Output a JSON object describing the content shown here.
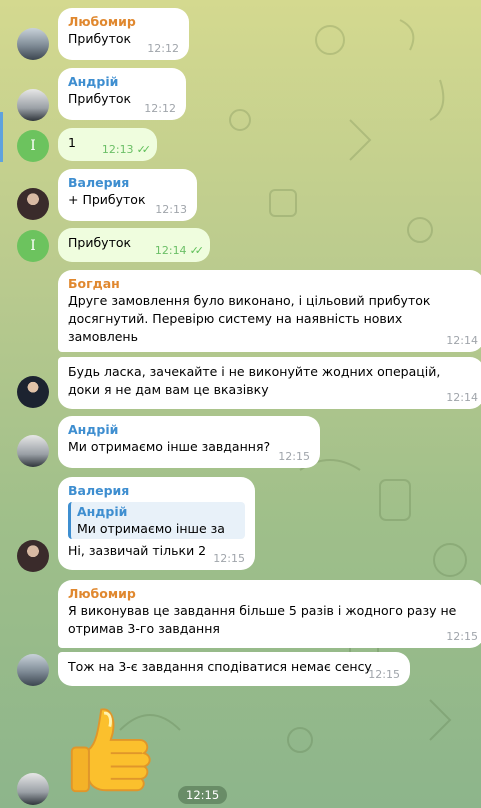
{
  "messages": [
    {
      "sender": "Любомир",
      "text": "Прибуток",
      "time": "12:12"
    },
    {
      "sender": "Андрій",
      "text": "Прибуток",
      "time": "12:12"
    },
    {
      "text": "1",
      "time": "12:13"
    },
    {
      "sender": "Валерия",
      "text": "+ Прибуток",
      "time": "12:13"
    },
    {
      "text": "Прибуток",
      "time": "12:14"
    },
    {
      "sender": "Богдан",
      "text": "Друге замовлення було виконано, і цільовий прибуток досягнутий. Перевірю систему на наявність нових замовлень",
      "time": "12:14"
    },
    {
      "text": "Будь ласка, зачекайте і не виконуйте жодних операцій, доки я не дам вам це вказівку",
      "time": "12:14"
    },
    {
      "sender": "Андрій",
      "text": "Ми отримаємо інше завдання?",
      "time": "12:15"
    },
    {
      "sender": "Валерия",
      "reply": {
        "name": "Андрій",
        "text": "Ми отримаємо інше за"
      },
      "text": "Ні, зазвичай тільки 2",
      "time": "12:15"
    },
    {
      "sender": "Любомир",
      "text": "Я виконував це завдання більше 5 разів і жодного разу не отримав 3-го завдання",
      "time": "12:15"
    },
    {
      "text": "Тож на 3-є завдання сподіватися немає сенсу",
      "time": "12:15"
    }
  ],
  "sticker_time": "12:15",
  "outgoing_avatar_letter": "I",
  "colors": {
    "accent": "#3e8ed0",
    "orange_name": "#e0882f",
    "outgoing": "#effdde",
    "check": "#5fbf58"
  }
}
